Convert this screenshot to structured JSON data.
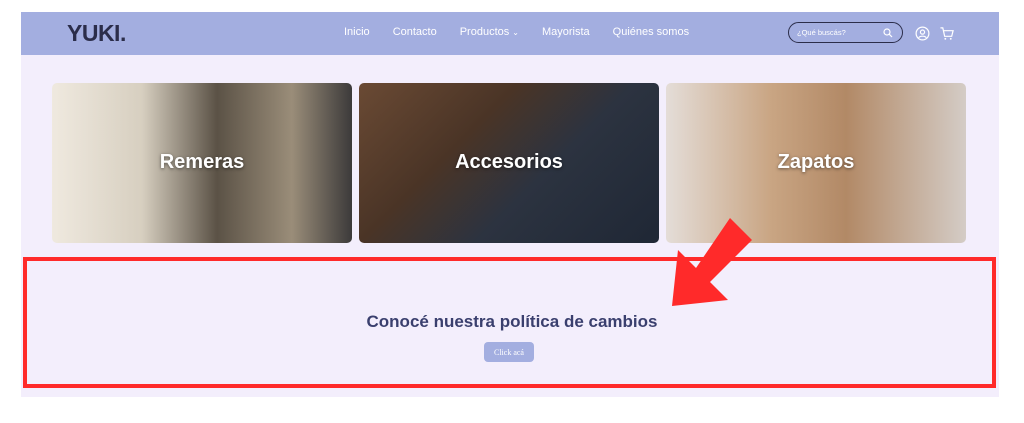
{
  "header": {
    "logo": "YUKI.",
    "nav": [
      {
        "label": "Inicio"
      },
      {
        "label": "Contacto"
      },
      {
        "label": "Productos",
        "has_dropdown": true
      },
      {
        "label": "Mayorista"
      },
      {
        "label": "Quiénes somos"
      }
    ],
    "search_placeholder": "¿Qué buscás?",
    "colors": {
      "bar": "#a3aee0",
      "logo": "#2b2d4a"
    }
  },
  "categories": [
    {
      "label": "Remeras"
    },
    {
      "label": "Accesorios"
    },
    {
      "label": "Zapatos"
    }
  ],
  "promo": {
    "title": "Conocé nuestra política de cambios",
    "button_label": "Click acá",
    "highlight_color": "#ff2a2a"
  },
  "icons": [
    "search-icon",
    "user-icon",
    "cart-icon",
    "chevron-down-icon",
    "arrow-annotation"
  ]
}
